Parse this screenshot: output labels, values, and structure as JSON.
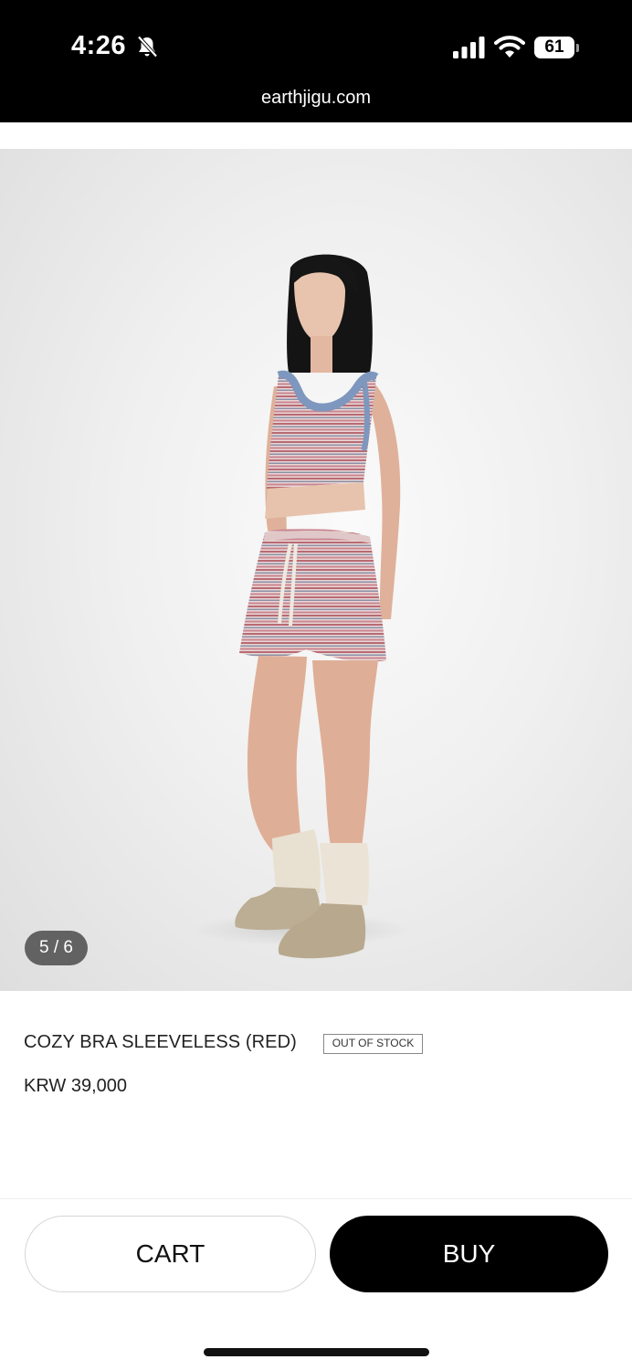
{
  "status_bar": {
    "time": "4:26",
    "battery": "61",
    "url": "earthjigu.com",
    "icons": [
      "bell-slash-icon",
      "signal-icon",
      "wifi-icon",
      "battery-icon"
    ]
  },
  "gallery": {
    "counter": "5 / 6",
    "current": 5,
    "total": 6
  },
  "product": {
    "name": "COZY BRA SLEEVELESS (RED)",
    "stock_badge": "OUT OF STOCK",
    "price": "KRW 39,000"
  },
  "actions": {
    "cart_label": "CART",
    "buy_label": "BUY"
  },
  "colors": {
    "status_bar_bg": "#000000",
    "buy_button_bg": "#000000",
    "cart_button_border": "#d6d6d6"
  }
}
